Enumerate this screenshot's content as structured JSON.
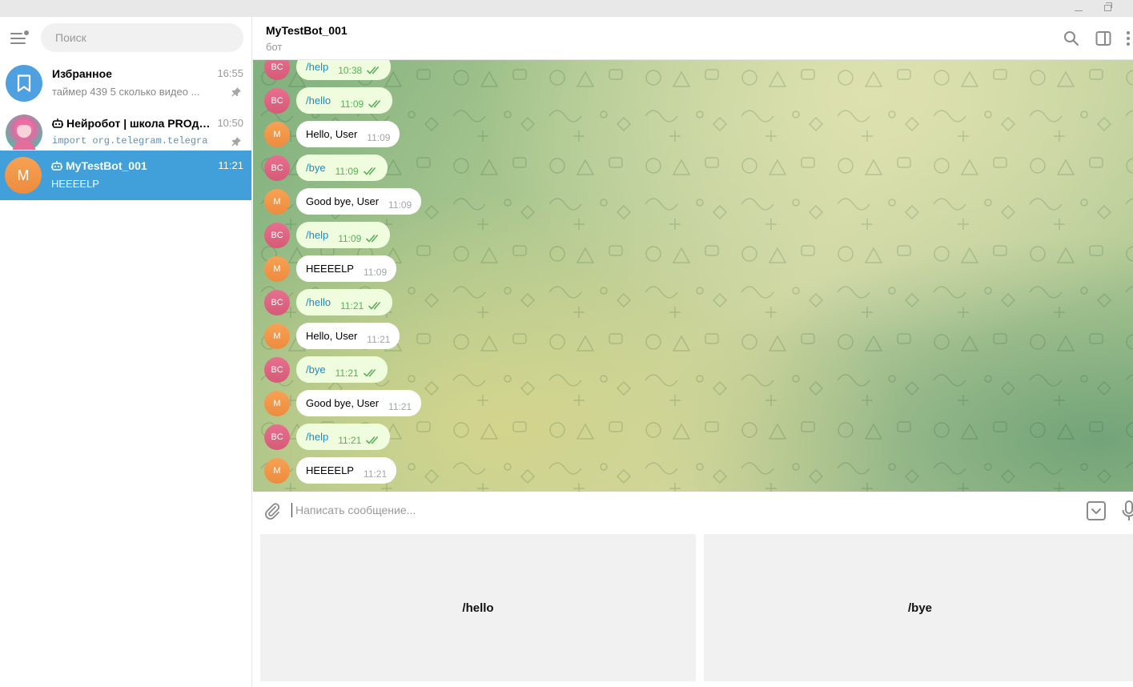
{
  "sidebar": {
    "search": {
      "placeholder": "Поиск"
    },
    "chats": [
      {
        "name": "Избранное",
        "time": "16:55",
        "preview": "таймер 439 5     сколько видео ...",
        "pinned": true,
        "icon": "bookmark-icon",
        "avatar_color": "#4fa0e0"
      },
      {
        "name": "Нейробот | школа PROдв...",
        "time": "10:50",
        "preview": "import org.telegram.telegra",
        "pinned": true,
        "icon": "bot-icon",
        "avatar_color": "#4bb2a6"
      },
      {
        "name": "MyTestBot_001",
        "time": "11:21",
        "preview": "HEEEELP",
        "pinned": false,
        "avatar_letter": "M",
        "active": true,
        "icon": "bot-icon"
      }
    ]
  },
  "header": {
    "title": "MyTestBot_001",
    "status": "бот",
    "icons": [
      "search-icon",
      "sidebar-toggle-icon",
      "more-icon"
    ]
  },
  "messages": [
    {
      "sender": "BC",
      "dir": "out",
      "text": "/help",
      "time": "10:38"
    },
    {
      "sender": "BC",
      "dir": "out",
      "text": "/hello",
      "time": "11:09"
    },
    {
      "sender": "M",
      "dir": "in",
      "text": "Hello, User",
      "time": "11:09"
    },
    {
      "sender": "BC",
      "dir": "out",
      "text": "/bye",
      "time": "11:09"
    },
    {
      "sender": "M",
      "dir": "in",
      "text": "Good bye, User",
      "time": "11:09"
    },
    {
      "sender": "BC",
      "dir": "out",
      "text": "/help",
      "time": "11:09"
    },
    {
      "sender": "M",
      "dir": "in",
      "text": "HEEEELP",
      "time": "11:09"
    },
    {
      "sender": "BC",
      "dir": "out",
      "text": "/hello",
      "time": "11:21"
    },
    {
      "sender": "M",
      "dir": "in",
      "text": "Hello, User",
      "time": "11:21"
    },
    {
      "sender": "BC",
      "dir": "out",
      "text": "/bye",
      "time": "11:21"
    },
    {
      "sender": "M",
      "dir": "in",
      "text": "Good bye, User",
      "time": "11:21"
    },
    {
      "sender": "BC",
      "dir": "out",
      "text": "/help",
      "time": "11:21"
    },
    {
      "sender": "M",
      "dir": "in",
      "text": "HEEEELP",
      "time": "11:21"
    }
  ],
  "composer": {
    "placeholder": "Написать сообщение..."
  },
  "keyboard": {
    "buttons": [
      "/hello",
      "/bye"
    ]
  },
  "colors": {
    "accent": "#419fd9",
    "outgoing_bubble": "#effdde",
    "outgoing_text": "#168acd",
    "check": "#5dae5c"
  }
}
